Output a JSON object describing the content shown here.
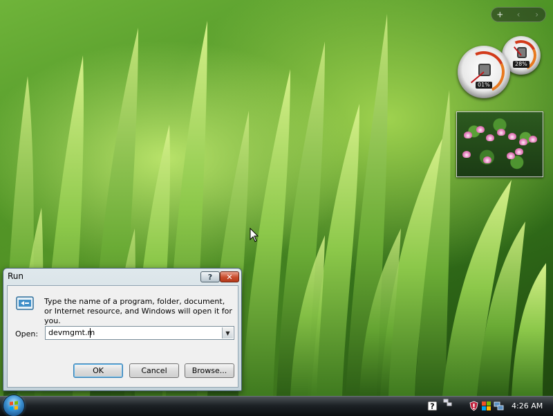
{
  "sidebar_controls": {
    "add": "+",
    "prev": "‹",
    "next": "›"
  },
  "cpu_meter": {
    "cpu_usage": "01%",
    "memory_usage": "28%"
  },
  "run_dialog": {
    "title": "Run",
    "help_label": "?",
    "close_label": "✕",
    "description": "Type the name of a program, folder, document, or Internet resource, and Windows will open it for you.",
    "open_label": "Open:",
    "open_value": "devmgmt.m",
    "ok_label": "OK",
    "cancel_label": "Cancel",
    "browse_label": "Browse..."
  },
  "taskbar": {
    "clock": "4:26 AM",
    "tray_icons": [
      "help-icon",
      "network-icon",
      "security-icon",
      "windows-update-icon",
      "network-status-icon"
    ]
  },
  "colors": {
    "title_close": "#c84b2b",
    "default_button_border": "#3c7fb1",
    "taskbar": "#1d2226"
  }
}
